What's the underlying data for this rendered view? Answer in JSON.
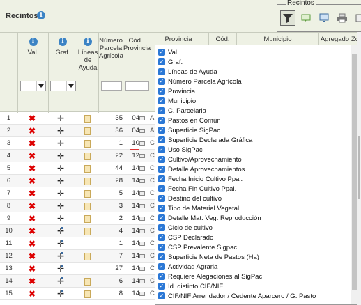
{
  "title": "Recintos",
  "toolbar": {
    "group_label": "Recintos"
  },
  "headers": {
    "val": "Val.",
    "graf": "Graf.",
    "lineas": "Líneas de Ayuda",
    "nparcela": "Número Parcela Agrícola",
    "cprov": "Cód. Provincia",
    "provincia": "Provincia",
    "cod": "Cód.",
    "municipio": "Municipio",
    "agregado": "Agregado",
    "ze": "Zo"
  },
  "rows": [
    {
      "n": "1",
      "parcela": "35",
      "prov": "04",
      "l": "A"
    },
    {
      "n": "2",
      "parcela": "36",
      "prov": "04",
      "l": "A"
    },
    {
      "n": "3",
      "parcela": "1",
      "prov": "10",
      "l": "C"
    },
    {
      "n": "4",
      "parcela": "22",
      "prov": "12",
      "l": "C"
    },
    {
      "n": "5",
      "parcela": "44",
      "prov": "14",
      "l": "C"
    },
    {
      "n": "6",
      "parcela": "28",
      "prov": "14",
      "l": "C"
    },
    {
      "n": "7",
      "parcela": "5",
      "prov": "14",
      "l": "C"
    },
    {
      "n": "8",
      "parcela": "3",
      "prov": "14",
      "l": "C"
    },
    {
      "n": "9",
      "parcela": "2",
      "prov": "14",
      "l": "C"
    },
    {
      "n": "10",
      "parcela": "4",
      "prov": "14",
      "l": "C"
    },
    {
      "n": "11",
      "parcela": "1",
      "prov": "14",
      "l": "C"
    },
    {
      "n": "12",
      "parcela": "7",
      "prov": "14",
      "l": "C"
    },
    {
      "n": "13",
      "parcela": "27",
      "prov": "14",
      "l": "C"
    },
    {
      "n": "14",
      "parcela": "6",
      "prov": "14",
      "l": "C"
    },
    {
      "n": "15",
      "parcela": "8",
      "prov": "14",
      "l": "C"
    }
  ],
  "columns_menu": [
    "Val.",
    "Graf.",
    "Líneas de Ayuda",
    "Número Parcela Agrícola",
    "Provincia",
    "Municipio",
    "C. Parcelaria",
    "Pastos en Común",
    "Superficie SigPac",
    "Superficie Declarada Gráfica",
    "Uso SigPac",
    "Cultivo/Aprovechamiento",
    "Detalle Aprovechamientos",
    "Fecha Inicio Cultivo Ppal.",
    "Fecha Fin Cultivo Ppal.",
    "Destino del cultivo",
    "Tipo de Material Vegetal",
    "Detalle Mat. Veg. Reproducción",
    "Ciclo de cultivo",
    "CSP Declarado",
    "CSP Prevalente Sigpac",
    "Superficie Neta de Pastos (Ha)",
    "Actividad Agraria",
    "Requiere Alegaciones al SigPac",
    "Id. distinto CIF/NIF",
    "CIF/NIF Arrendador / Cedente Aparcero / G. Pasto"
  ]
}
